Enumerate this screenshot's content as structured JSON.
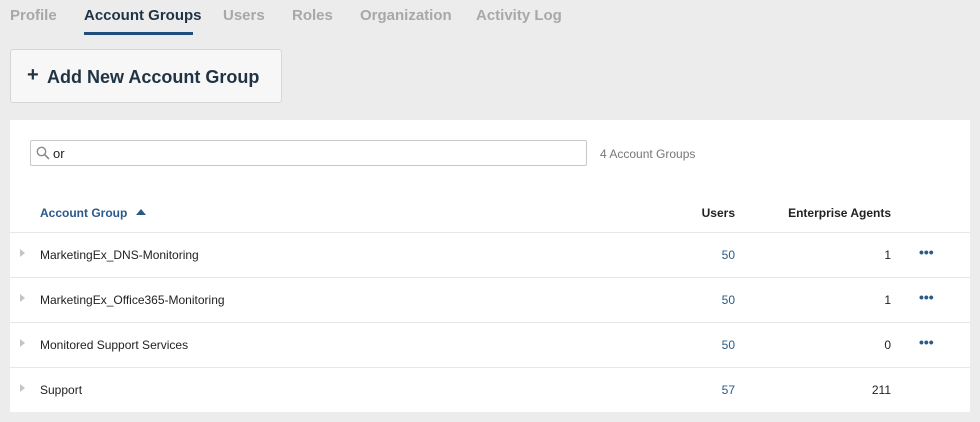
{
  "tabs": [
    {
      "label": "Profile",
      "active": false
    },
    {
      "label": "Account Groups",
      "active": true
    },
    {
      "label": "Users",
      "active": false
    },
    {
      "label": "Roles",
      "active": false
    },
    {
      "label": "Organization",
      "active": false
    },
    {
      "label": "Activity Log",
      "active": false
    }
  ],
  "add_button": {
    "icon": "+",
    "label": "Add New Account Group"
  },
  "search": {
    "value": "or",
    "icon": "search-icon"
  },
  "result_count": "4 Account Groups",
  "table": {
    "columns": {
      "account_group": "Account Group",
      "users": "Users",
      "agents": "Enterprise Agents"
    },
    "sort": {
      "column": "account_group",
      "direction": "ascending"
    },
    "rows": [
      {
        "name": "MarketingEx_DNS-Monitoring",
        "users": "50",
        "agents": "1",
        "menu": "•••"
      },
      {
        "name": "MarketingEx_Office365-Monitoring",
        "users": "50",
        "agents": "1",
        "menu": "•••"
      },
      {
        "name": "Monitored Support Services",
        "users": "50",
        "agents": "0",
        "menu": "•••"
      },
      {
        "name": "Support",
        "users": "57",
        "agents": "211",
        "menu": ""
      }
    ]
  },
  "colors": {
    "accent": "#1f4e7a",
    "link": "#2a5a8a",
    "background": "#ececec"
  }
}
